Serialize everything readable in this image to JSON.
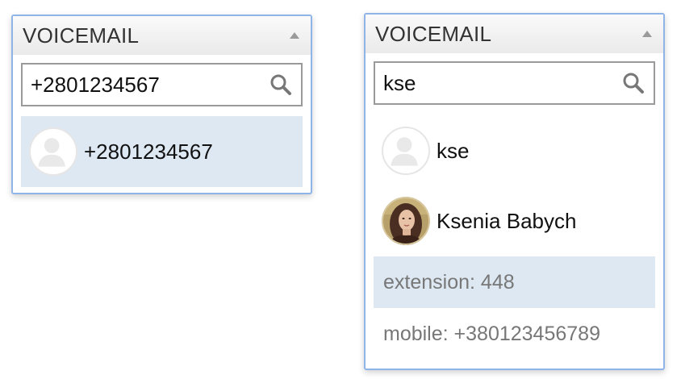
{
  "left_panel": {
    "header_title": "VOICEMAIL",
    "search_value": "+2801234567",
    "results": [
      {
        "name": "+2801234567",
        "avatar": "person-placeholder-icon"
      }
    ]
  },
  "right_panel": {
    "header_title": "VOICEMAIL",
    "search_value": "kse",
    "results": [
      {
        "name": "kse",
        "avatar": "person-placeholder-icon"
      },
      {
        "name": "Ksenia Babych",
        "avatar": "photo"
      }
    ],
    "details": [
      {
        "text": "extension: 448",
        "highlighted": true
      },
      {
        "text": "mobile: +380123456789",
        "highlighted": false
      }
    ]
  },
  "colors": {
    "panel_border": "#8fb4e8",
    "highlight": "#dde8f2",
    "detail_text": "#777777"
  }
}
